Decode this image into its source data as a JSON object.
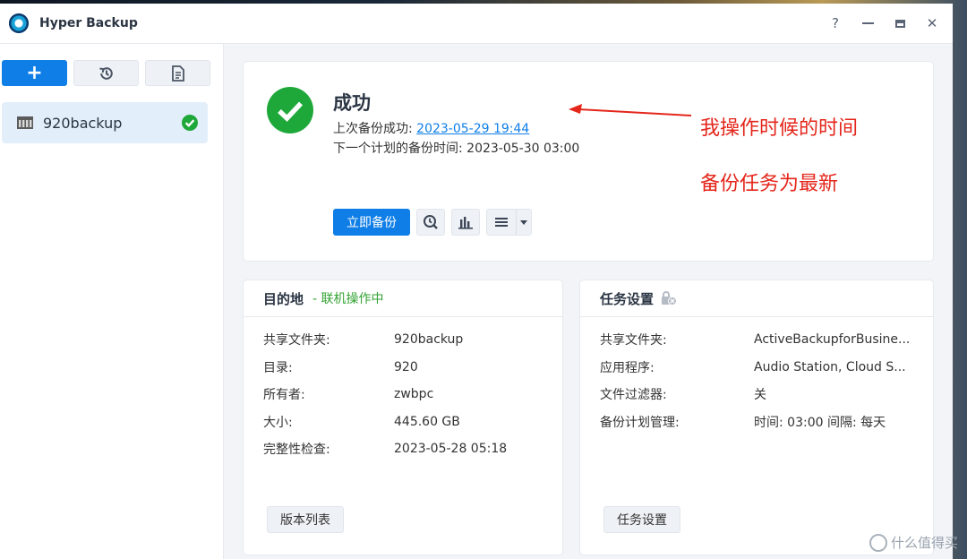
{
  "window": {
    "title": "Hyper Backup"
  },
  "titlebar": {
    "help_glyph": "?",
    "close_glyph": "✕"
  },
  "sidebar": {
    "toolbar": [
      "plus-icon",
      "restore-history-icon",
      "log-icon"
    ],
    "tasks": [
      {
        "label": "920backup",
        "status": "success"
      }
    ]
  },
  "status": {
    "title": "成功",
    "last_backup_label": "上次备份成功:",
    "last_backup_value": "2023-05-29 19:44",
    "next_backup_label": "下一个计划的备份时间:",
    "next_backup_value": "2023-05-30 03:00",
    "backup_now_label": "立即备份"
  },
  "annotations": {
    "line1": "我操作时候的时间",
    "line2": "备份任务为最新"
  },
  "destination": {
    "title": "目的地",
    "state": "- 联机操作中",
    "rows": [
      {
        "key": "共享文件夹:",
        "value": "920backup"
      },
      {
        "key": "目录:",
        "value": "920"
      },
      {
        "key": "所有者:",
        "value": "zwbpc"
      },
      {
        "key": "大小:",
        "value": "445.60 GB"
      },
      {
        "key": "完整性检查:",
        "value": "2023-05-28 05:18"
      }
    ],
    "button_label": "版本列表"
  },
  "task_settings": {
    "title": "任务设置",
    "rows": [
      {
        "key": "共享文件夹:",
        "value": "ActiveBackupforBusine..."
      },
      {
        "key": "应用程序:",
        "value": "Audio Station, Cloud S..."
      },
      {
        "key": "文件过滤器:",
        "value": "关"
      },
      {
        "key": "备份计划管理:",
        "value": "时间: 03:00 间隔: 每天"
      }
    ],
    "button_label": "任务设置"
  },
  "watermark": {
    "text": "什么值得买"
  },
  "colors": {
    "accent": "#0f7ee6",
    "success": "#1fa83a",
    "annotation": "#e4261b",
    "online": "#33a333"
  }
}
